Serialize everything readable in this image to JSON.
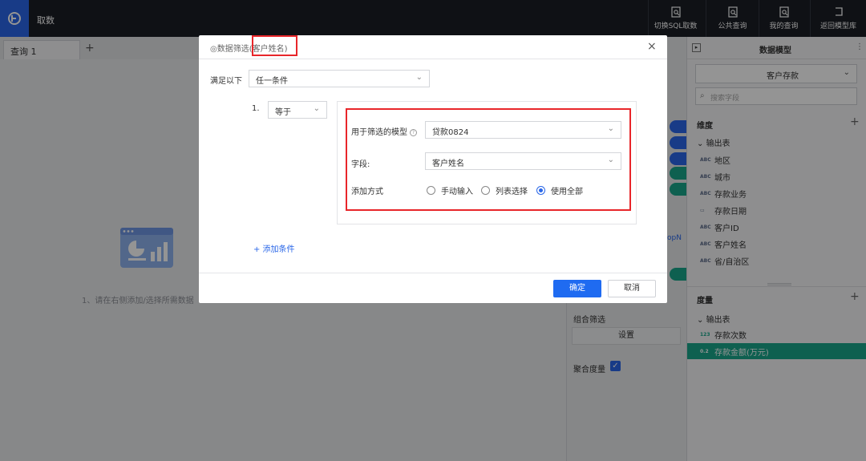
{
  "app": {
    "title": "取数"
  },
  "toolbar": [
    {
      "label": "切换SQL取数",
      "icon": "sql-switch-icon"
    },
    {
      "label": "公共查询",
      "icon": "public-query-icon"
    },
    {
      "label": "我的查询",
      "icon": "my-query-icon"
    },
    {
      "label": "返回模型库",
      "icon": "return-icon"
    }
  ],
  "tabs": {
    "items": [
      {
        "label": "查询 1"
      }
    ],
    "add": "+"
  },
  "canvas": {
    "empty_text": "1、请在右侧添加/选择所需数据"
  },
  "middle": {
    "topn": "opN",
    "combo_filter_label": "组合筛选",
    "settings_button": "设置",
    "agg_measure_label": "聚合度量",
    "agg_measure_checked": true,
    "pill_colors": [
      "#2a67e8",
      "#2a67e8",
      "#2a67e8",
      "#19a58a",
      "#19a58a",
      "#19a58a"
    ]
  },
  "right_panel": {
    "title": "数据模型",
    "model_select": "客户存款",
    "search_placeholder": "搜索字段",
    "dimensions": {
      "title": "维度",
      "group": "输出表",
      "fields": [
        {
          "type": "ABC",
          "name": "地区"
        },
        {
          "type": "ABC",
          "name": "城市"
        },
        {
          "type": "ABC",
          "name": "存款业务"
        },
        {
          "type": "DATE",
          "name": "存款日期"
        },
        {
          "type": "ABC",
          "name": "客户ID"
        },
        {
          "type": "ABC",
          "name": "客户姓名"
        },
        {
          "type": "ABC",
          "name": "省/自治区"
        }
      ]
    },
    "measures": {
      "title": "度量",
      "group": "输出表",
      "fields": [
        {
          "type": "123",
          "name": "存款次数",
          "selected": false
        },
        {
          "type": "0.2",
          "name": "存款金额(万元)",
          "selected": true
        }
      ]
    }
  },
  "modal": {
    "title": "◎数据筛选(客户姓名)",
    "satisfy_label": "满足以下",
    "satisfy_value": "任一条件",
    "condition_index": "1.",
    "operator_value": "等于",
    "model_label": "用于筛选的模型",
    "model_value": "贷款0824",
    "field_label": "字段:",
    "field_value": "客户姓名",
    "method_label": "添加方式",
    "methods": [
      {
        "label": "手动输入",
        "checked": false
      },
      {
        "label": "列表选择",
        "checked": false
      },
      {
        "label": "使用全部",
        "checked": true
      }
    ],
    "add_condition": "+ 添加条件",
    "ok": "确定",
    "cancel": "取消",
    "close": "×"
  },
  "colors": {
    "accent": "#2a67e8",
    "teal": "#19a58a",
    "annotation": "#e8262a"
  }
}
